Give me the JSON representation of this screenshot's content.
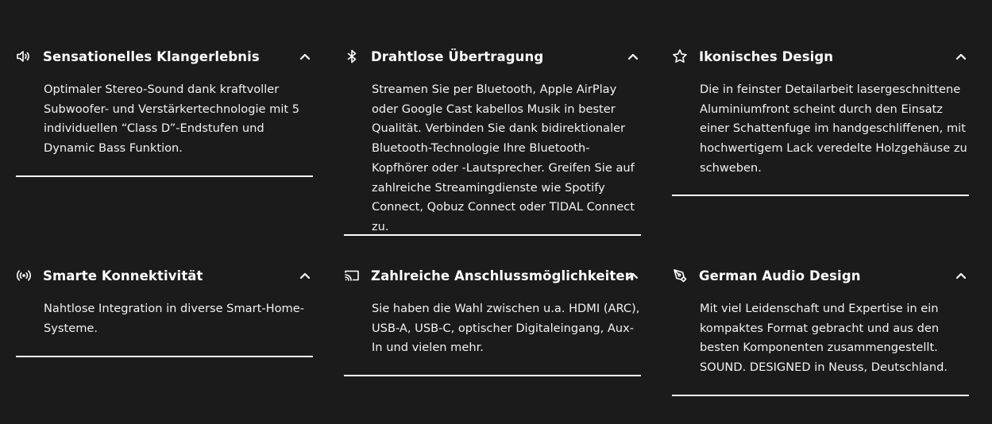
{
  "features": [
    {
      "icon": "speaker-icon",
      "title": "Sensationelles Klangerlebnis",
      "text": "Optimaler Stereo-Sound dank kraftvoller Subwoofer- und Verstärkertechnologie mit 5 individuellen “Class D”-Endstufen und Dynamic Bass Funktion."
    },
    {
      "icon": "bluetooth-icon",
      "title": "Drahtlose Übertragung",
      "text": "Streamen Sie per Bluetooth, Apple AirPlay oder Google Cast kabellos Musik in bester Qualität. Verbinden Sie dank bidirektionaler Bluetooth-Technologie Ihre Bluetooth-Kopfhörer oder -Lautsprecher. Greifen Sie auf zahlreiche Streamingdienste wie Spotify Connect, Qobuz Connect oder TIDAL Connect zu."
    },
    {
      "icon": "star-icon",
      "title": "Ikonisches Design",
      "text": "Die in feinster Detailarbeit lasergeschnittene Aluminiumfront scheint durch den Einsatz einer Schattenfuge im handgeschliffenen, mit hochwertigem Lack veredelte Holzgehäuse zu schweben."
    },
    {
      "icon": "broadcast-icon",
      "title": "Smarte Konnektivität",
      "text": "Nahtlose Integration in diverse Smart-Home-Systeme."
    },
    {
      "icon": "cast-icon",
      "title": "Zahlreiche Anschlussmöglichkeiten",
      "text": "Sie haben die Wahl zwischen u.a. HDMI (ARC), USB-A, USB-C, optischer Digitaleingang, Aux-In und vielen mehr."
    },
    {
      "icon": "pen-nib-icon",
      "title": "German Audio Design",
      "text": "Mit viel Leidenschaft und Expertise in ein kompaktes Format gebracht und aus den besten Komponenten zusammengestellt. SOUND. DESIGNED in Neuss, Deutschland."
    }
  ],
  "colors": {
    "background": "#1b1b1b",
    "text": "#ffffff"
  }
}
